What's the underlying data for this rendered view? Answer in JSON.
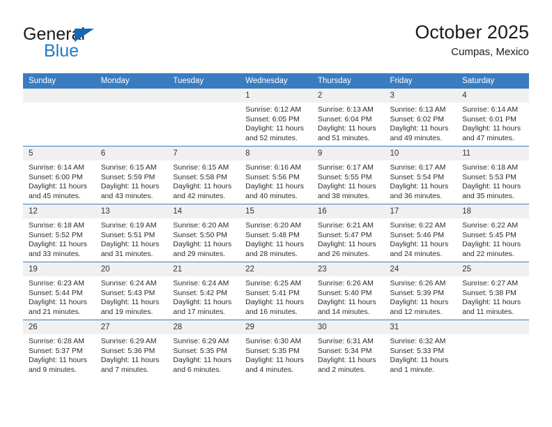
{
  "brand": {
    "name_top": "General",
    "name_bottom": "Blue",
    "color_dark": "#1a1a1a",
    "color_blue": "#1f7ac4",
    "triangle_color": "#1268b3"
  },
  "header": {
    "title": "October 2025",
    "subtitle": "Cumpas, Mexico"
  },
  "theme": {
    "header_row_bg": "#3a7cc0",
    "header_row_text": "#ffffff",
    "daynum_bg": "#f0f0f0",
    "grid_line": "#3a7cc0",
    "body_text": "#2b2b2b"
  },
  "weekday_headers": [
    "Sunday",
    "Monday",
    "Tuesday",
    "Wednesday",
    "Thursday",
    "Friday",
    "Saturday"
  ],
  "labels": {
    "sunrise_prefix": "Sunrise:",
    "sunset_prefix": "Sunset:",
    "daylight_prefix": "Daylight:"
  },
  "weeks": [
    [
      {
        "day": "",
        "empty": true,
        "sunrise": "",
        "sunset": "",
        "daylight_line1": "",
        "daylight_line2": ""
      },
      {
        "day": "",
        "empty": true,
        "sunrise": "",
        "sunset": "",
        "daylight_line1": "",
        "daylight_line2": ""
      },
      {
        "day": "",
        "empty": true,
        "sunrise": "",
        "sunset": "",
        "daylight_line1": "",
        "daylight_line2": ""
      },
      {
        "day": "1",
        "empty": false,
        "sunrise": "Sunrise: 6:12 AM",
        "sunset": "Sunset: 6:05 PM",
        "daylight_line1": "Daylight: 11 hours",
        "daylight_line2": "and 52 minutes."
      },
      {
        "day": "2",
        "empty": false,
        "sunrise": "Sunrise: 6:13 AM",
        "sunset": "Sunset: 6:04 PM",
        "daylight_line1": "Daylight: 11 hours",
        "daylight_line2": "and 51 minutes."
      },
      {
        "day": "3",
        "empty": false,
        "sunrise": "Sunrise: 6:13 AM",
        "sunset": "Sunset: 6:02 PM",
        "daylight_line1": "Daylight: 11 hours",
        "daylight_line2": "and 49 minutes."
      },
      {
        "day": "4",
        "empty": false,
        "sunrise": "Sunrise: 6:14 AM",
        "sunset": "Sunset: 6:01 PM",
        "daylight_line1": "Daylight: 11 hours",
        "daylight_line2": "and 47 minutes."
      }
    ],
    [
      {
        "day": "5",
        "empty": false,
        "sunrise": "Sunrise: 6:14 AM",
        "sunset": "Sunset: 6:00 PM",
        "daylight_line1": "Daylight: 11 hours",
        "daylight_line2": "and 45 minutes."
      },
      {
        "day": "6",
        "empty": false,
        "sunrise": "Sunrise: 6:15 AM",
        "sunset": "Sunset: 5:59 PM",
        "daylight_line1": "Daylight: 11 hours",
        "daylight_line2": "and 43 minutes."
      },
      {
        "day": "7",
        "empty": false,
        "sunrise": "Sunrise: 6:15 AM",
        "sunset": "Sunset: 5:58 PM",
        "daylight_line1": "Daylight: 11 hours",
        "daylight_line2": "and 42 minutes."
      },
      {
        "day": "8",
        "empty": false,
        "sunrise": "Sunrise: 6:16 AM",
        "sunset": "Sunset: 5:56 PM",
        "daylight_line1": "Daylight: 11 hours",
        "daylight_line2": "and 40 minutes."
      },
      {
        "day": "9",
        "empty": false,
        "sunrise": "Sunrise: 6:17 AM",
        "sunset": "Sunset: 5:55 PM",
        "daylight_line1": "Daylight: 11 hours",
        "daylight_line2": "and 38 minutes."
      },
      {
        "day": "10",
        "empty": false,
        "sunrise": "Sunrise: 6:17 AM",
        "sunset": "Sunset: 5:54 PM",
        "daylight_line1": "Daylight: 11 hours",
        "daylight_line2": "and 36 minutes."
      },
      {
        "day": "11",
        "empty": false,
        "sunrise": "Sunrise: 6:18 AM",
        "sunset": "Sunset: 5:53 PM",
        "daylight_line1": "Daylight: 11 hours",
        "daylight_line2": "and 35 minutes."
      }
    ],
    [
      {
        "day": "12",
        "empty": false,
        "sunrise": "Sunrise: 6:18 AM",
        "sunset": "Sunset: 5:52 PM",
        "daylight_line1": "Daylight: 11 hours",
        "daylight_line2": "and 33 minutes."
      },
      {
        "day": "13",
        "empty": false,
        "sunrise": "Sunrise: 6:19 AM",
        "sunset": "Sunset: 5:51 PM",
        "daylight_line1": "Daylight: 11 hours",
        "daylight_line2": "and 31 minutes."
      },
      {
        "day": "14",
        "empty": false,
        "sunrise": "Sunrise: 6:20 AM",
        "sunset": "Sunset: 5:50 PM",
        "daylight_line1": "Daylight: 11 hours",
        "daylight_line2": "and 29 minutes."
      },
      {
        "day": "15",
        "empty": false,
        "sunrise": "Sunrise: 6:20 AM",
        "sunset": "Sunset: 5:48 PM",
        "daylight_line1": "Daylight: 11 hours",
        "daylight_line2": "and 28 minutes."
      },
      {
        "day": "16",
        "empty": false,
        "sunrise": "Sunrise: 6:21 AM",
        "sunset": "Sunset: 5:47 PM",
        "daylight_line1": "Daylight: 11 hours",
        "daylight_line2": "and 26 minutes."
      },
      {
        "day": "17",
        "empty": false,
        "sunrise": "Sunrise: 6:22 AM",
        "sunset": "Sunset: 5:46 PM",
        "daylight_line1": "Daylight: 11 hours",
        "daylight_line2": "and 24 minutes."
      },
      {
        "day": "18",
        "empty": false,
        "sunrise": "Sunrise: 6:22 AM",
        "sunset": "Sunset: 5:45 PM",
        "daylight_line1": "Daylight: 11 hours",
        "daylight_line2": "and 22 minutes."
      }
    ],
    [
      {
        "day": "19",
        "empty": false,
        "sunrise": "Sunrise: 6:23 AM",
        "sunset": "Sunset: 5:44 PM",
        "daylight_line1": "Daylight: 11 hours",
        "daylight_line2": "and 21 minutes."
      },
      {
        "day": "20",
        "empty": false,
        "sunrise": "Sunrise: 6:24 AM",
        "sunset": "Sunset: 5:43 PM",
        "daylight_line1": "Daylight: 11 hours",
        "daylight_line2": "and 19 minutes."
      },
      {
        "day": "21",
        "empty": false,
        "sunrise": "Sunrise: 6:24 AM",
        "sunset": "Sunset: 5:42 PM",
        "daylight_line1": "Daylight: 11 hours",
        "daylight_line2": "and 17 minutes."
      },
      {
        "day": "22",
        "empty": false,
        "sunrise": "Sunrise: 6:25 AM",
        "sunset": "Sunset: 5:41 PM",
        "daylight_line1": "Daylight: 11 hours",
        "daylight_line2": "and 16 minutes."
      },
      {
        "day": "23",
        "empty": false,
        "sunrise": "Sunrise: 6:26 AM",
        "sunset": "Sunset: 5:40 PM",
        "daylight_line1": "Daylight: 11 hours",
        "daylight_line2": "and 14 minutes."
      },
      {
        "day": "24",
        "empty": false,
        "sunrise": "Sunrise: 6:26 AM",
        "sunset": "Sunset: 5:39 PM",
        "daylight_line1": "Daylight: 11 hours",
        "daylight_line2": "and 12 minutes."
      },
      {
        "day": "25",
        "empty": false,
        "sunrise": "Sunrise: 6:27 AM",
        "sunset": "Sunset: 5:38 PM",
        "daylight_line1": "Daylight: 11 hours",
        "daylight_line2": "and 11 minutes."
      }
    ],
    [
      {
        "day": "26",
        "empty": false,
        "sunrise": "Sunrise: 6:28 AM",
        "sunset": "Sunset: 5:37 PM",
        "daylight_line1": "Daylight: 11 hours",
        "daylight_line2": "and 9 minutes."
      },
      {
        "day": "27",
        "empty": false,
        "sunrise": "Sunrise: 6:29 AM",
        "sunset": "Sunset: 5:36 PM",
        "daylight_line1": "Daylight: 11 hours",
        "daylight_line2": "and 7 minutes."
      },
      {
        "day": "28",
        "empty": false,
        "sunrise": "Sunrise: 6:29 AM",
        "sunset": "Sunset: 5:35 PM",
        "daylight_line1": "Daylight: 11 hours",
        "daylight_line2": "and 6 minutes."
      },
      {
        "day": "29",
        "empty": false,
        "sunrise": "Sunrise: 6:30 AM",
        "sunset": "Sunset: 5:35 PM",
        "daylight_line1": "Daylight: 11 hours",
        "daylight_line2": "and 4 minutes."
      },
      {
        "day": "30",
        "empty": false,
        "sunrise": "Sunrise: 6:31 AM",
        "sunset": "Sunset: 5:34 PM",
        "daylight_line1": "Daylight: 11 hours",
        "daylight_line2": "and 2 minutes."
      },
      {
        "day": "31",
        "empty": false,
        "sunrise": "Sunrise: 6:32 AM",
        "sunset": "Sunset: 5:33 PM",
        "daylight_line1": "Daylight: 11 hours",
        "daylight_line2": "and 1 minute."
      },
      {
        "day": "",
        "empty": true,
        "sunrise": "",
        "sunset": "",
        "daylight_line1": "",
        "daylight_line2": ""
      }
    ]
  ]
}
